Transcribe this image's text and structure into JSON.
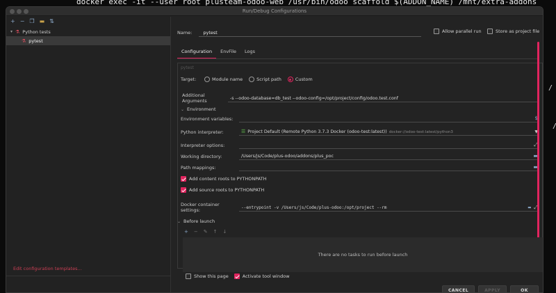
{
  "terminal": {
    "command": "docker exec -it --user root plusteam-odoo-web /usr/bin/odoo scaffold $(ADDON_NAME) /mnt/extra-addons"
  },
  "dialog": {
    "title": "Run/Debug Configurations"
  },
  "left": {
    "group_label": "Python tests",
    "child_label": "pytest",
    "edit_templates": "Edit configuration templates..."
  },
  "header": {
    "name_label": "Name:",
    "name_value": "pytest",
    "allow_parallel": "Allow parallel run",
    "store_as_file": "Store as project file"
  },
  "tabs": [
    "Configuration",
    "EnvFile",
    "Logs"
  ],
  "config": {
    "hint": "pytest",
    "target_label": "Target:",
    "target_options": [
      "Module name",
      "Script path",
      "Custom"
    ],
    "target_selected": "Custom",
    "additional_args_label": "Additional Arguments",
    "additional_args_value": "-s --odoo-database=db_test --odoo-config=/opt/project/config/odoo.test.conf",
    "environment_title": "Environment",
    "env_vars_label": "Environment variables:",
    "env_vars_icon": "$",
    "interpreter_label": "Python interpreter:",
    "interpreter_value": "Project Default (Remote Python 3.7.3 Docker (odoo-test:latest))",
    "interpreter_sub": "docker://odoo-test:latest/python3",
    "interpreter_options_label": "Interpreter options:",
    "working_dir_label": "Working directory:",
    "working_dir_value": "/Users/js/Code/plus-odoo/addons/plus_poc",
    "path_mappings_label": "Path mappings:",
    "add_content_roots": "Add content roots to PYTHONPATH",
    "add_source_roots": "Add source roots to PYTHONPATH",
    "docker_settings_label": "Docker container settings:",
    "docker_settings_value": "--entrypoint -v /Users/js/Code/plus-odoo:/opt/project --rm"
  },
  "before_launch": {
    "title": "Before launch",
    "empty_text": "There are no tasks to run before launch",
    "toolbar": [
      "+",
      "−",
      "✎",
      "↑",
      "↓"
    ]
  },
  "footer": {
    "show_page": "Show this page",
    "activate_tool": "Activate tool window",
    "cancel": "CANCEL",
    "apply": "APPLY",
    "ok": "OK"
  },
  "colors": {
    "accent": "#e0245e",
    "background": "#232323"
  }
}
